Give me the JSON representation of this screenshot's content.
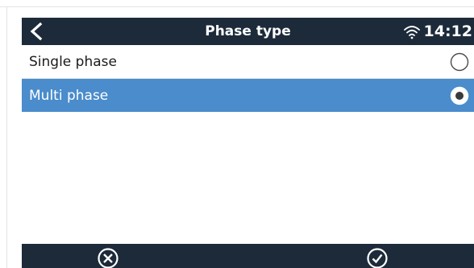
{
  "header": {
    "back_icon": "chevron-left-icon",
    "title": "Phase type",
    "wifi_icon": "wifi-icon",
    "time": "14:12"
  },
  "options": [
    {
      "label": "Single phase",
      "selected": false
    },
    {
      "label": "Multi phase",
      "selected": true
    }
  ],
  "footer": {
    "cancel_icon": "cancel-circle-icon",
    "confirm_icon": "confirm-check-icon"
  },
  "colors": {
    "header_bg": "#1c2a3a",
    "selected_row": "#4a8ccc",
    "text": "#1b1b1b"
  }
}
